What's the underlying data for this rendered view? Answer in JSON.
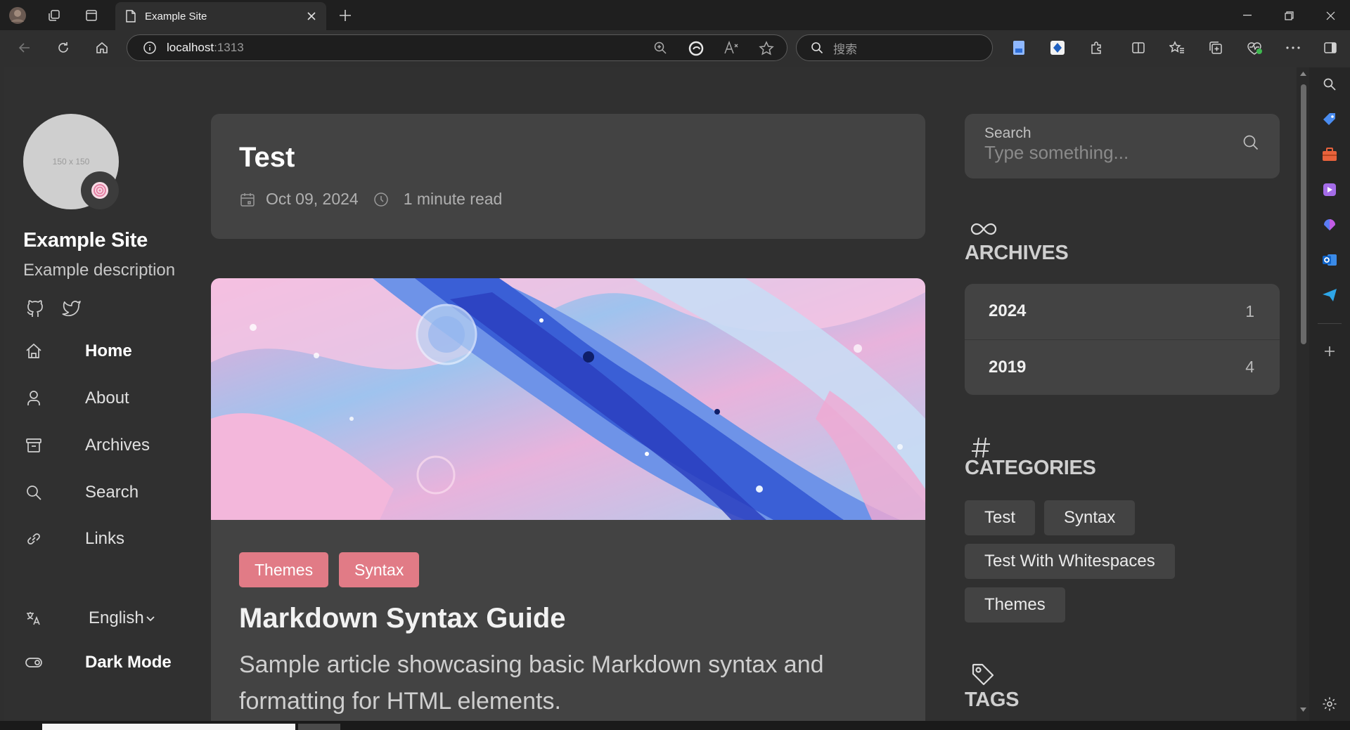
{
  "browser": {
    "tab_title": "Example Site",
    "url_host": "localhost",
    "url_port": ":1313",
    "search_placeholder": "搜索"
  },
  "sidebar": {
    "avatar_placeholder": "150 x 150",
    "site_title": "Example Site",
    "site_description": "Example description",
    "social": [
      "github-icon",
      "twitter-icon"
    ],
    "nav": [
      {
        "label": "Home",
        "icon": "home-icon",
        "active": true
      },
      {
        "label": "About",
        "icon": "user-icon"
      },
      {
        "label": "Archives",
        "icon": "archive-icon"
      },
      {
        "label": "Search",
        "icon": "search-icon"
      },
      {
        "label": "Links",
        "icon": "link-icon"
      }
    ],
    "language": "English",
    "dark_mode_label": "Dark Mode"
  },
  "post": {
    "title": "Test",
    "date": "Oct 09, 2024",
    "read_time": "1 minute read"
  },
  "article": {
    "categories": [
      "Themes",
      "Syntax"
    ],
    "title": "Markdown Syntax Guide",
    "subtitle": "Sample article showcasing basic Markdown syntax and formatting for HTML elements."
  },
  "widgets": {
    "search": {
      "label": "Search",
      "placeholder": "Type something..."
    },
    "archives": {
      "heading": "ARCHIVES",
      "rows": [
        {
          "year": "2024",
          "count": "1"
        },
        {
          "year": "2019",
          "count": "4"
        }
      ]
    },
    "categories": {
      "heading": "CATEGORIES",
      "items": [
        "Test",
        "Syntax",
        "Test With Whitespaces",
        "Themes"
      ]
    },
    "tags": {
      "heading": "TAGS"
    }
  },
  "colors": {
    "accent_pill": "#e17b86",
    "card": "#434343",
    "background": "#303030"
  }
}
